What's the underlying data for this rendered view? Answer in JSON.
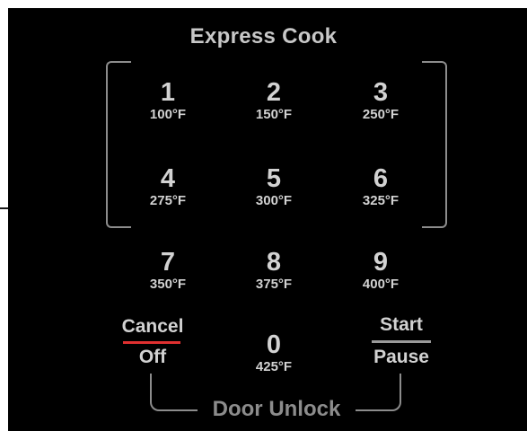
{
  "title": "Express Cook",
  "keys": [
    {
      "num": "1",
      "temp": "100°F"
    },
    {
      "num": "2",
      "temp": "150°F"
    },
    {
      "num": "3",
      "temp": "250°F"
    },
    {
      "num": "4",
      "temp": "275°F"
    },
    {
      "num": "5",
      "temp": "300°F"
    },
    {
      "num": "6",
      "temp": "325°F"
    },
    {
      "num": "7",
      "temp": "350°F"
    },
    {
      "num": "8",
      "temp": "375°F"
    },
    {
      "num": "9",
      "temp": "400°F"
    },
    {
      "num": "0",
      "temp": "425°F"
    }
  ],
  "cancel": {
    "top": "Cancel",
    "bottom": "Off"
  },
  "start": {
    "top": "Start",
    "bottom": "Pause"
  },
  "door_unlock": "Door Unlock",
  "colors": {
    "background": "#000000",
    "text": "#d2d2d2",
    "frame": "#8c8c8c",
    "cancel_accent": "#e03030"
  }
}
